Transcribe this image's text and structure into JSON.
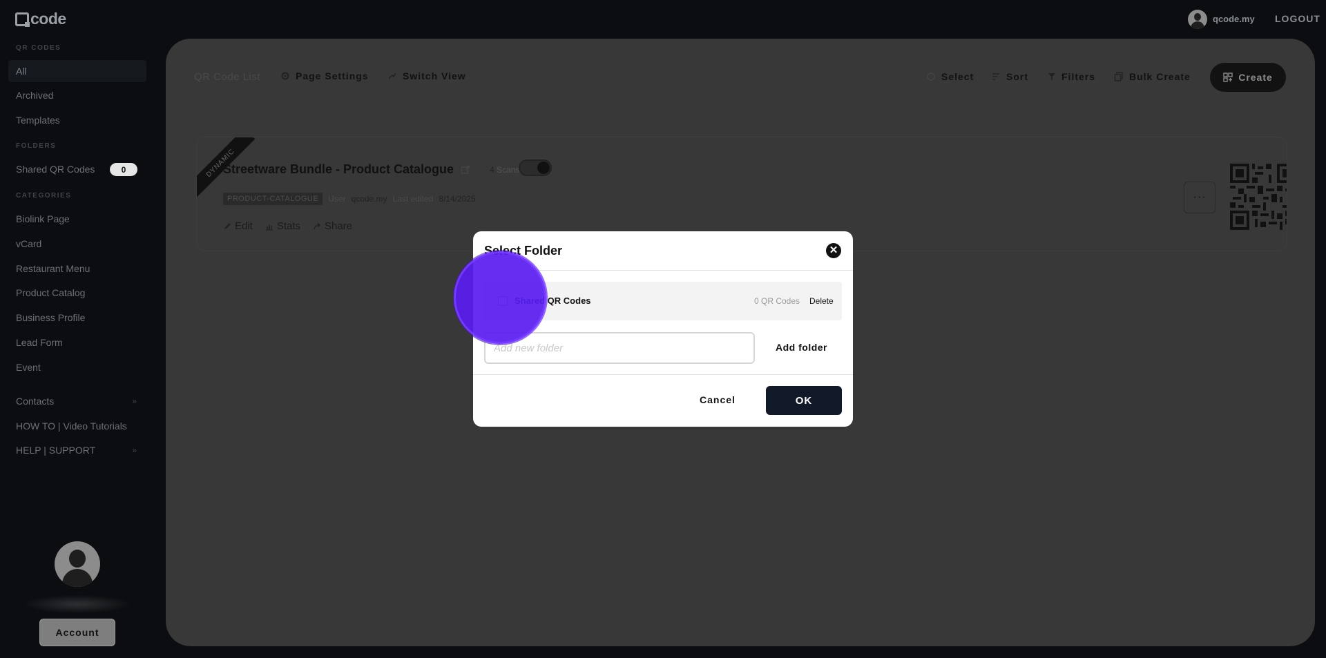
{
  "brand": {
    "logo_text": "code"
  },
  "sidebar": {
    "sections": {
      "qr_codes": "QR CODES",
      "folders": "FOLDERS",
      "categories": "CATEGORIES"
    },
    "items": [
      {
        "label": "All",
        "active": true
      },
      {
        "label": "Archived"
      },
      {
        "label": "Templates"
      }
    ],
    "folders": [
      {
        "label": "Shared QR Codes",
        "count": "0"
      }
    ],
    "categories": [
      {
        "label": "Biolink Page"
      },
      {
        "label": "vCard"
      },
      {
        "label": "Restaurant Menu"
      },
      {
        "label": "Product Catalog"
      },
      {
        "label": "Business Profile"
      },
      {
        "label": "Lead Form"
      },
      {
        "label": "Event"
      }
    ],
    "bottom_links": [
      {
        "label": "Contacts",
        "chevron": "»"
      },
      {
        "label": "HOW TO | Video Tutorials"
      },
      {
        "label": "HELP | SUPPORT",
        "chevron": "»"
      }
    ],
    "account_button": "Account"
  },
  "topbar": {
    "username": "qcode.my",
    "logout": "LOGOUT"
  },
  "toolbar": {
    "list_label": "QR Code List",
    "page_settings": "Page Settings",
    "switch_view": "Switch View",
    "select": "Select",
    "sort": "Sort",
    "filters": "Filters",
    "bulk_create": "Bulk Create",
    "create": "Create"
  },
  "qr_card": {
    "ribbon": "DYNAMIC",
    "title": "Streetware Bundle - Product Catalogue",
    "scans_count": "4",
    "scans_label": "Scans",
    "tag": "PRODUCT-CATALOGUE",
    "user_label": "User",
    "user_value": "qcode.my",
    "edited_label": "Last edited",
    "edited_value": "8/14/2025",
    "actions": {
      "edit": "Edit",
      "stats": "Stats",
      "share": "Share"
    },
    "more": "···"
  },
  "modal": {
    "title": "Select Folder",
    "folder": {
      "name": "Shared QR Codes",
      "count": "0 QR Codes",
      "delete": "Delete"
    },
    "new_folder_placeholder": "Add new folder",
    "add_folder": "Add folder",
    "cancel": "Cancel",
    "ok": "OK"
  },
  "colors": {
    "accent_click": "#5a1cf0",
    "dark_button": "#111827",
    "background": "#0b0d10",
    "panel": "#383838"
  }
}
